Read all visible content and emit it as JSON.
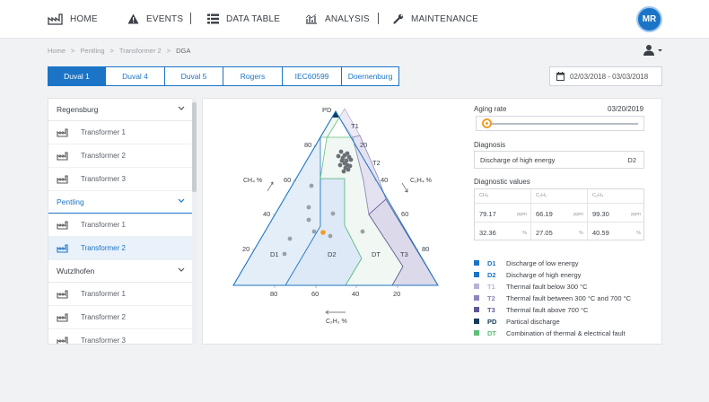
{
  "nav": {
    "home": "HOME",
    "events": "EVENTS",
    "data_table": "DATA TABLE",
    "analysis": "ANALYSIS",
    "maintenance": "MAINTENANCE",
    "logo": "MR"
  },
  "breadcrumb": [
    "Home",
    ">",
    "Pentling",
    ">",
    "Transformer 2",
    ">",
    "DGA"
  ],
  "tabs": [
    "Duval 1",
    "Duval 4",
    "Duval 5",
    "Rogers",
    "IEC60599",
    "Doernenburg"
  ],
  "date_range": "02/03/2018  -  03/03/2018",
  "sidebar": {
    "groups": [
      {
        "name": "Regensburg",
        "items": [
          "Transformer 1",
          "Transformer 2",
          "Transformer 3"
        ]
      },
      {
        "name": "Pentling",
        "items": [
          "Transformer 1",
          "Transformer 2"
        ]
      },
      {
        "name": "Wutzlhofen",
        "items": [
          "Transformer 1",
          "Transformer 2",
          "Transformer 3"
        ]
      }
    ]
  },
  "duval": {
    "apex_label": "PD",
    "zones": [
      "T1",
      "T2",
      "D1",
      "D2",
      "DT",
      "T3"
    ],
    "left_axis_label": "CH₄ %",
    "right_axis_label": "C₂H₄ %",
    "bottom_axis_label": "C₂H₂ %",
    "left_ticks": [
      "80",
      "60",
      "40",
      "20"
    ],
    "right_ticks": [
      "20",
      "40",
      "60",
      "80"
    ],
    "bottom_ticks": [
      "80",
      "60",
      "40",
      "20"
    ]
  },
  "aging": {
    "label": "Aging rate",
    "date": "03/20/2019",
    "level": 0.02
  },
  "diagnosis": {
    "label": "Diagnosis",
    "text": "Discharge of high energy",
    "code": "D2"
  },
  "diagnostic_values": {
    "label": "Diagnostic values",
    "headers": [
      "CH₄",
      "C₂H₂",
      "C₂H₄"
    ],
    "rows": [
      [
        {
          "v": "79.17",
          "u": "ppm"
        },
        {
          "v": "66.19",
          "u": "ppm"
        },
        {
          "v": "99.30",
          "u": "ppm"
        }
      ],
      [
        {
          "v": "32.36",
          "u": "%"
        },
        {
          "v": "27.05",
          "u": "%"
        },
        {
          "v": "40.59",
          "u": "%"
        }
      ]
    ]
  },
  "legend": [
    {
      "code": "D1",
      "text": "Discharge of low energy",
      "color": "#1b74c6"
    },
    {
      "code": "D2",
      "text": "Discharge of high energy",
      "color": "#1b74c6"
    },
    {
      "code": "T1",
      "text": "Thermal fault below 300 °C",
      "color": "#b8b3d6"
    },
    {
      "code": "T2",
      "text": "Thermal fault between 300 °C and 700 °C",
      "color": "#8c86bd"
    },
    {
      "code": "T3",
      "text": "Thermal fault above 700 °C",
      "color": "#5d5796"
    },
    {
      "code": "PD",
      "text": "Partical discharge",
      "color": "#143b5c"
    },
    {
      "code": "DT",
      "text": "Combination of thermal & electrical fault",
      "color": "#5fbf7a"
    }
  ],
  "colors": {
    "accent": "#1b74c6",
    "current_point": "#f39c2a",
    "history_point": "#9aa0a6"
  }
}
